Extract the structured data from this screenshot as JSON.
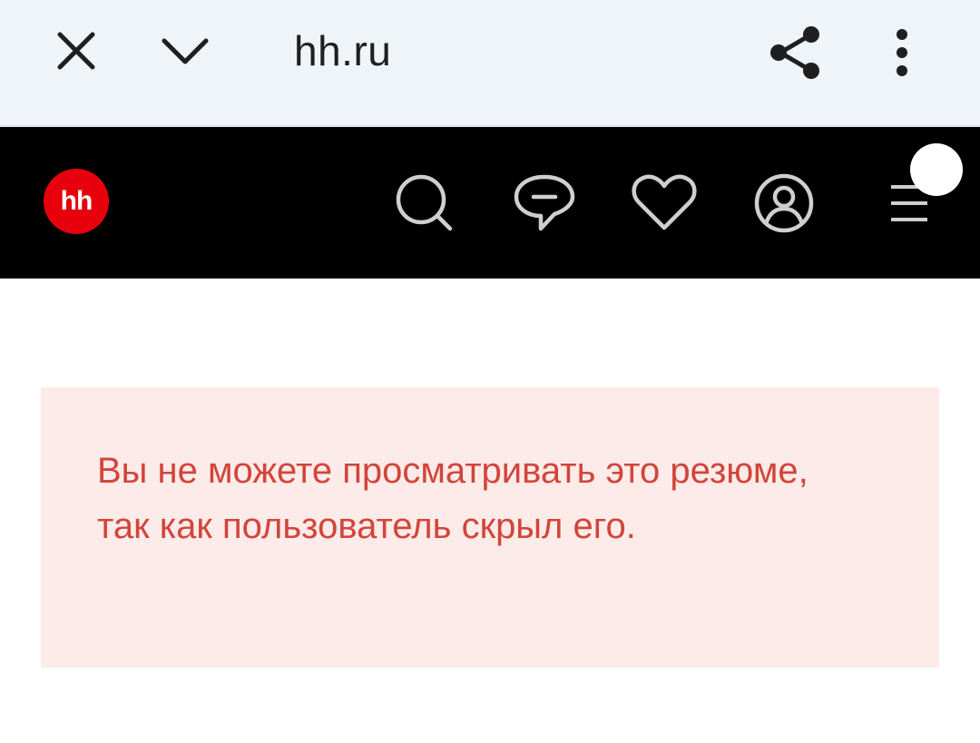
{
  "browser": {
    "url": "hh.ru",
    "icons": {
      "close": "close-icon",
      "collapse": "chevron-down-icon",
      "share": "share-icon",
      "menu": "more-vertical-icon"
    }
  },
  "header": {
    "logo_text": "hh",
    "logo_color": "#e8000c",
    "background": "#000000",
    "nav_icons": [
      "search-icon",
      "chat-icon",
      "heart-icon",
      "profile-icon",
      "menu-icon"
    ]
  },
  "alert": {
    "message": "Вы не можете просматривать это резюме, так как пользователь скрыл его.",
    "background": "#fcebe8",
    "text_color": "#d1453b"
  }
}
